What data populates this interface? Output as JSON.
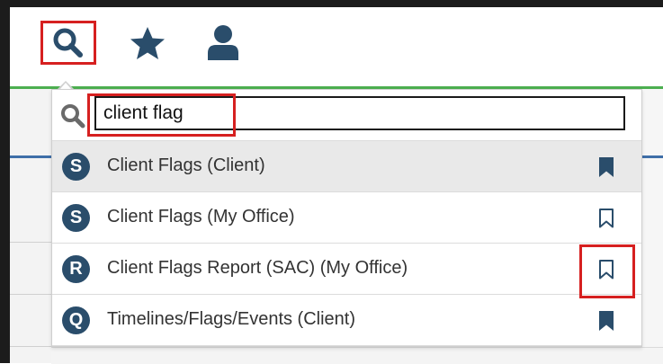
{
  "colors": {
    "accent_highlight": "#d62020",
    "icon_navy": "#2a4d6b",
    "header_divider_green": "#4caf50",
    "active_row_bg": "#e9e9e9"
  },
  "toolbar": {
    "items": [
      {
        "icon": "search-icon",
        "highlighted": true
      },
      {
        "icon": "star-icon",
        "highlighted": false
      },
      {
        "icon": "user-icon",
        "highlighted": false
      }
    ]
  },
  "search": {
    "icon": "search-icon",
    "value": "client flag",
    "highlighted": true
  },
  "results": [
    {
      "badge": "S",
      "label": "Client Flags (Client)",
      "bookmarked": true,
      "active": true,
      "bookmark_highlighted": false
    },
    {
      "badge": "S",
      "label": "Client Flags (My Office)",
      "bookmarked": false,
      "active": false,
      "bookmark_highlighted": false
    },
    {
      "badge": "R",
      "label": "Client Flags Report (SAC) (My Office)",
      "bookmarked": false,
      "active": false,
      "bookmark_highlighted": true
    },
    {
      "badge": "Q",
      "label": "Timelines/Flags/Events (Client)",
      "bookmarked": true,
      "active": false,
      "bookmark_highlighted": false
    }
  ]
}
